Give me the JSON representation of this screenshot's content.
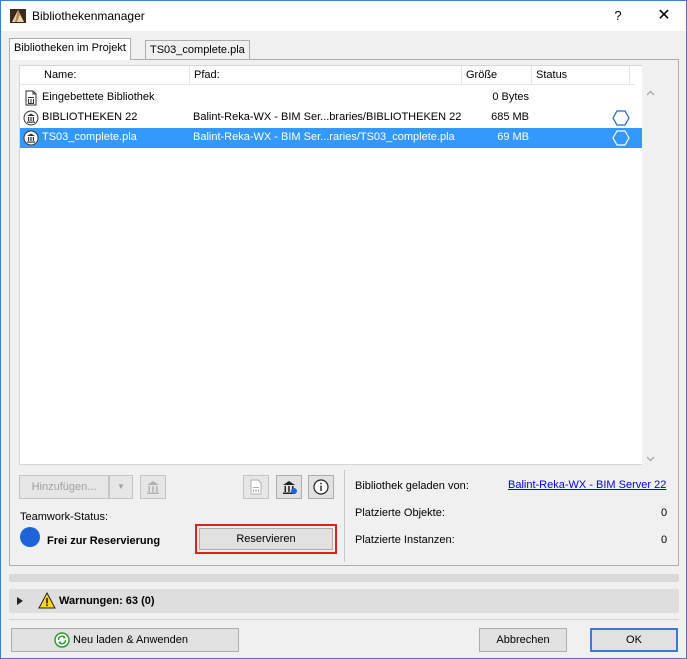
{
  "window": {
    "title": "Bibliothekenmanager",
    "help_label": "?",
    "close_label": "✕"
  },
  "tabs": [
    {
      "label": "Bibliotheken im Projekt",
      "active": true
    },
    {
      "label": "TS03_complete.pla",
      "active": false
    }
  ],
  "table": {
    "columns": [
      "Name:",
      "Pfad:",
      "Größe",
      "Status"
    ],
    "rows": [
      {
        "icon": "embedded-library-icon",
        "name": "Eingebettete Bibliothek",
        "path": "",
        "size": "0 Bytes",
        "status": ""
      },
      {
        "icon": "library-icon",
        "name": "BIBLIOTHEKEN 22",
        "path": "Balint-Reka-WX - BIM Ser...braries/BIBLIOTHEKEN 22",
        "size": "685 MB",
        "status": "bimserver-hex-icon"
      },
      {
        "icon": "library-icon",
        "name": "TS03_complete.pla",
        "path": "Balint-Reka-WX - BIM Ser...raries/TS03_complete.pla",
        "size": "69 MB",
        "status": "bimserver-hex-icon",
        "selected": true
      }
    ]
  },
  "toolbar": {
    "add_label": "Hinzufügen...",
    "dropdown_arrow": "▼"
  },
  "teamwork": {
    "label": "Teamwork-Status:",
    "status_text": "Frei zur Reservierung",
    "reserve_label": "Reservieren"
  },
  "info": {
    "loaded_from_label": "Bibliothek geladen von:",
    "loaded_from_value": "Balint-Reka-WX - BIM Server 22",
    "placed_objects_label": "Platzierte Objekte:",
    "placed_objects_value": "0",
    "placed_instances_label": "Platzierte Instanzen:",
    "placed_instances_value": "0"
  },
  "warnings": {
    "label": "Warnungen: 63 (0)"
  },
  "footer": {
    "reload_label": "Neu laden & Anwenden",
    "cancel_label": "Abbrechen",
    "ok_label": "OK"
  },
  "colors": {
    "selection": "#3399ff",
    "accent": "#3a7bd5",
    "status_blue": "#1f63d8",
    "highlight_red": "#e0201e"
  }
}
